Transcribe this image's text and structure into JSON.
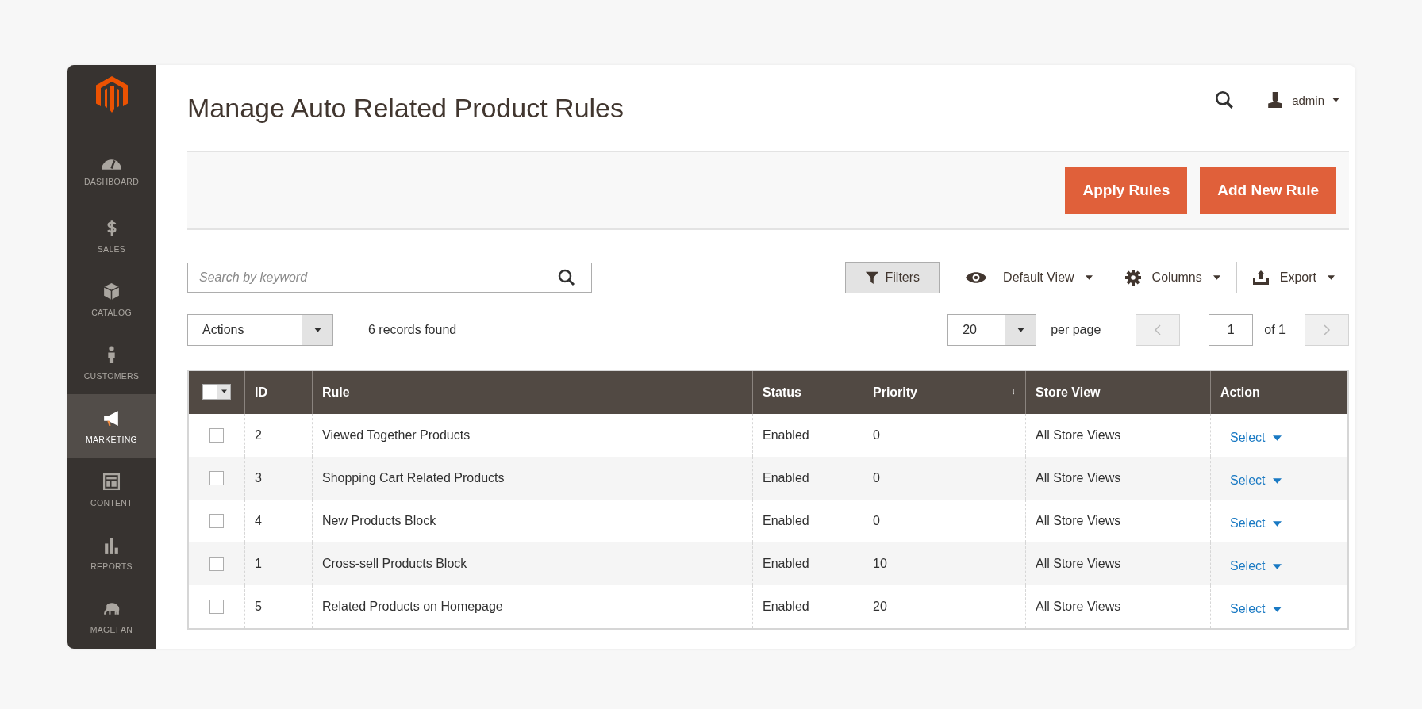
{
  "sidebar": {
    "items": [
      {
        "label": "DASHBOARD",
        "selected": false
      },
      {
        "label": "SALES",
        "selected": false
      },
      {
        "label": "CATALOG",
        "selected": false
      },
      {
        "label": "CUSTOMERS",
        "selected": false
      },
      {
        "label": "MARKETING",
        "selected": true
      },
      {
        "label": "CONTENT",
        "selected": false
      },
      {
        "label": "REPORTS",
        "selected": false
      },
      {
        "label": "MAGEFAN",
        "selected": false
      }
    ]
  },
  "header": {
    "title": "Manage Auto Related Product Rules",
    "user": "admin"
  },
  "page_actions": [
    "Apply Rules",
    "Add New Rule"
  ],
  "search": {
    "placeholder": "Search by keyword"
  },
  "toolbar": {
    "filters": "Filters",
    "view": "Default View",
    "columns": "Columns",
    "export": "Export"
  },
  "actions_select": {
    "value": "Actions"
  },
  "records_found": "6 records found",
  "pager": {
    "per_page_value": "20",
    "per_page_label": "per page",
    "page": "1",
    "of": "of 1",
    "prev": {
      "disabled": true
    },
    "next": {
      "disabled": true
    }
  },
  "table": {
    "select_all": {
      "checked": false
    },
    "columns": [
      {
        "label": "ID"
      },
      {
        "label": "Rule"
      },
      {
        "label": "Status"
      },
      {
        "label": "Priority",
        "sort_mark": "↓"
      },
      {
        "label": "Store View"
      },
      {
        "label": "Action"
      }
    ],
    "rows": [
      {
        "checked": false,
        "id": "2",
        "rule": "Viewed Together Products",
        "status": "Enabled",
        "priority": "0",
        "store_view": "All Store Views",
        "action": "Select"
      },
      {
        "checked": false,
        "id": "3",
        "rule": "Shopping Cart Related Products",
        "status": "Enabled",
        "priority": "0",
        "store_view": "All Store Views",
        "action": "Select"
      },
      {
        "checked": false,
        "id": "4",
        "rule": "New Products Block",
        "status": "Enabled",
        "priority": "0",
        "store_view": "All Store Views",
        "action": "Select"
      },
      {
        "checked": false,
        "id": "1",
        "rule": "Cross-sell Products Block",
        "status": "Enabled",
        "priority": "10",
        "store_view": "All Store Views",
        "action": "Select"
      },
      {
        "checked": false,
        "id": "5",
        "rule": "Related Products on Homepage",
        "status": "Enabled",
        "priority": "20",
        "store_view": "All Store Views",
        "action": "Select"
      }
    ]
  }
}
